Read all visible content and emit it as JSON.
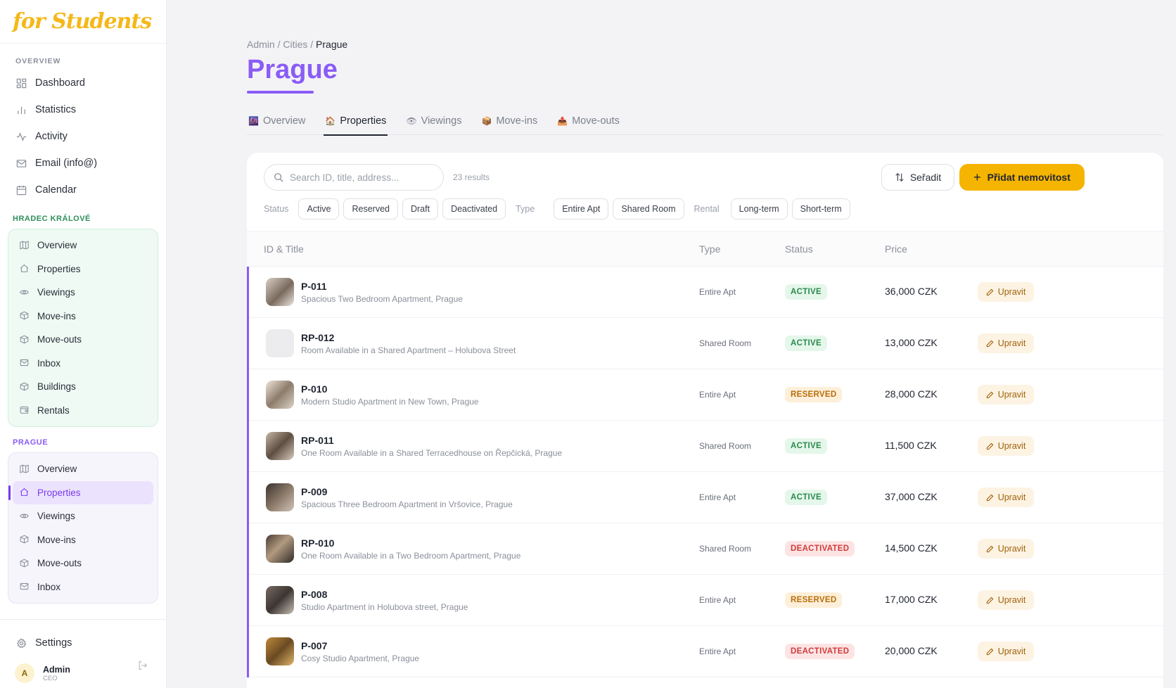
{
  "app": {
    "logo_text": "for Students"
  },
  "sidebar": {
    "overview_label": "OVERVIEW",
    "main_items": [
      {
        "label": "Dashboard",
        "icon": "grid-icon"
      },
      {
        "label": "Statistics",
        "icon": "bar-chart-icon"
      },
      {
        "label": "Activity",
        "icon": "activity-icon"
      },
      {
        "label": "Email (info@)",
        "icon": "mail-icon"
      },
      {
        "label": "Calendar",
        "icon": "calendar-icon"
      }
    ],
    "cities": [
      {
        "name": "HRADEC KRÁLOVÉ",
        "items": [
          "Overview",
          "Properties",
          "Viewings",
          "Move-ins",
          "Move-outs",
          "Inbox",
          "Buildings",
          "Rentals"
        ]
      },
      {
        "name": "PRAGUE",
        "items": [
          "Overview",
          "Properties",
          "Viewings",
          "Move-ins",
          "Move-outs",
          "Inbox"
        ],
        "active_item": "Properties"
      }
    ],
    "settings_label": "Settings",
    "user": {
      "initial": "A",
      "name": "Admin",
      "role": "CEO"
    }
  },
  "breadcrumb": {
    "parts": [
      "Admin /",
      "Cities /"
    ],
    "current": "Prague"
  },
  "page": {
    "title": "Prague"
  },
  "tabs": [
    {
      "label": "Overview",
      "emoji": "🌆"
    },
    {
      "label": "Properties",
      "emoji": "🏠",
      "active": true
    },
    {
      "label": "Viewings",
      "emoji": "👁"
    },
    {
      "label": "Move-ins",
      "emoji": "📦"
    },
    {
      "label": "Move-outs",
      "emoji": "📤"
    }
  ],
  "toolbar": {
    "search_placeholder": "Search ID, title, address...",
    "results": "23 results",
    "sort_label": "Seřadit",
    "add_label": "Přidat nemovitost",
    "filters": {
      "status_label": "Status",
      "status_chips": [
        "Active",
        "Reserved",
        "Draft",
        "Deactivated"
      ],
      "type_label": "Type",
      "type_chips": [
        "Entire Apt",
        "Shared Room"
      ],
      "rental_label": "Rental",
      "rental_chips": [
        "Long-term",
        "Short-term"
      ]
    }
  },
  "table": {
    "headers": {
      "id_title": "ID & Title",
      "type": "Type",
      "status": "Status",
      "price": "Price"
    },
    "edit_label": "Upravit",
    "rows": [
      {
        "id": "P-011",
        "title": "Spacious Two Bedroom Apartment, Prague",
        "type": "Entire Apt",
        "status": "ACTIVE",
        "status_kind": "active",
        "price": "36,000 CZK"
      },
      {
        "id": "RP-012",
        "title": "Room Available in a Shared Apartment – Holubova Street",
        "type": "Shared Room",
        "status": "ACTIVE",
        "status_kind": "active",
        "price": "13,000 CZK"
      },
      {
        "id": "P-010",
        "title": "Modern Studio Apartment in New Town, Prague",
        "type": "Entire Apt",
        "status": "RESERVED",
        "status_kind": "reserved",
        "price": "28,000 CZK"
      },
      {
        "id": "RP-011",
        "title": "One Room Available in a Shared Terracedhouse on Řepčická, Prague",
        "type": "Shared Room",
        "status": "ACTIVE",
        "status_kind": "active",
        "price": "11,500 CZK"
      },
      {
        "id": "P-009",
        "title": "Spacious Three Bedroom Apartment in Vršovice, Prague",
        "type": "Entire Apt",
        "status": "ACTIVE",
        "status_kind": "active",
        "price": "37,000 CZK"
      },
      {
        "id": "RP-010",
        "title": "One Room Available in a Two Bedroom Apartment, Prague",
        "type": "Shared Room",
        "status": "DEACTIVATED",
        "status_kind": "deactivated",
        "price": "14,500 CZK"
      },
      {
        "id": "P-008",
        "title": "Studio Apartment in Holubova street, Prague",
        "type": "Entire Apt",
        "status": "RESERVED",
        "status_kind": "reserved",
        "price": "17,000 CZK"
      },
      {
        "id": "P-007",
        "title": "Cosy Studio Apartment, Prague",
        "type": "Entire Apt",
        "status": "DEACTIVATED",
        "status_kind": "deactivated",
        "price": "20,000 CZK"
      }
    ]
  },
  "colors": {
    "accent": "#8b5cf6",
    "primary_button": "#f5b400",
    "hradec_green": "#2f8f5b"
  }
}
